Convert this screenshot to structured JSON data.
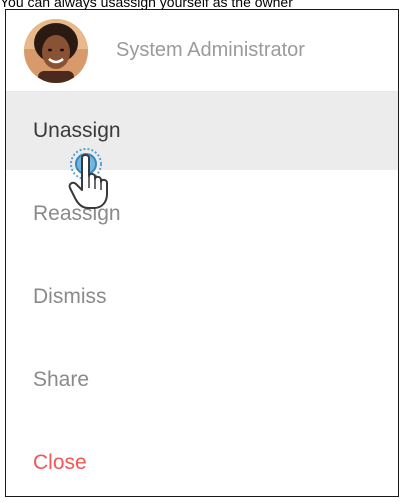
{
  "caption": "You can always usassign yourself as the owner",
  "user": {
    "name": "System Administrator",
    "avatar_icon": "user-avatar-photo"
  },
  "menu": {
    "items": [
      {
        "label": "Unassign",
        "state": "hover"
      },
      {
        "label": "Reassign"
      },
      {
        "label": "Dismiss"
      },
      {
        "label": "Share"
      },
      {
        "label": "Close",
        "color": "#f25757"
      }
    ]
  },
  "cursor_icon": "hand-pointer-icon",
  "colors": {
    "hover_bg": "#ececec",
    "muted_text": "#8a8a8a",
    "danger": "#f25757",
    "click_ring": "#2f8fd0"
  }
}
